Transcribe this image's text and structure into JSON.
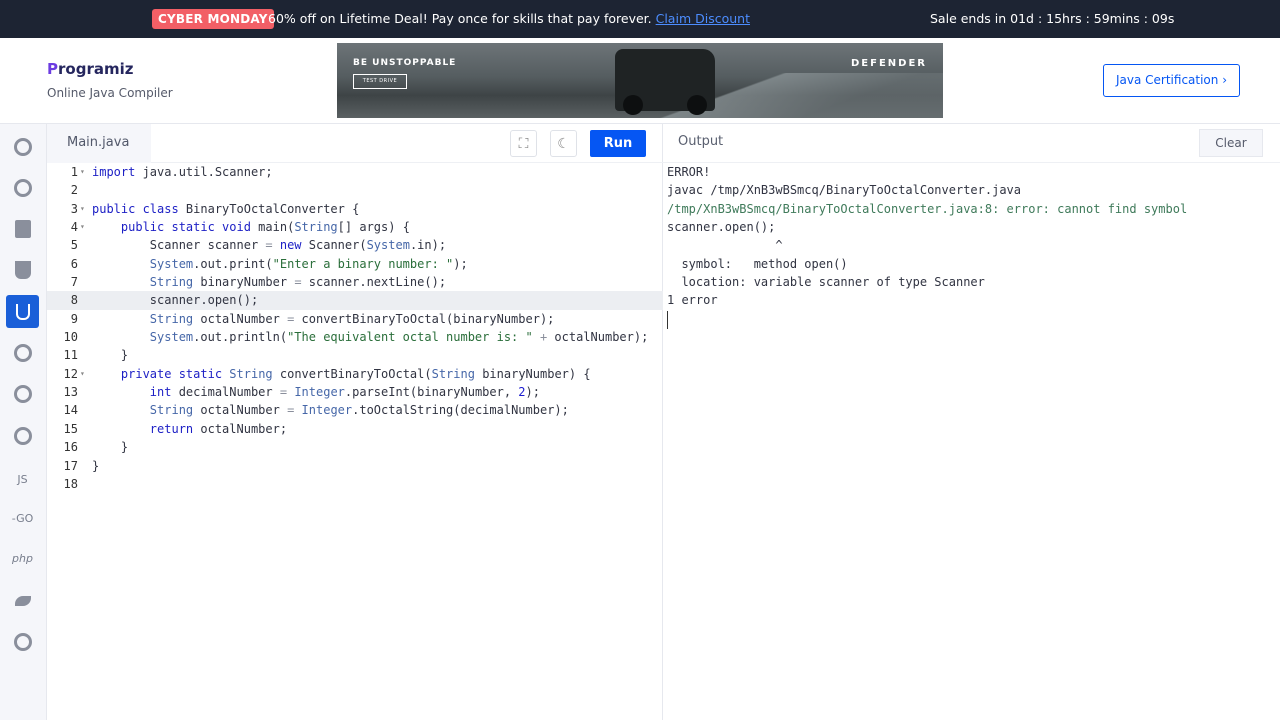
{
  "promo": {
    "badge": "CYBER MONDAY",
    "message": "60% off on Lifetime Deal! Pay once for skills that pay forever.",
    "link": "Claim Discount",
    "timer": "Sale ends in 01d : 15hrs : 59mins : 09s"
  },
  "header": {
    "logo": "rogramiz",
    "logo_p": "P",
    "subtitle": "Online Java Compiler",
    "ad_tagline": "BE UNSTOPPABLE",
    "ad_button": "TEST DRIVE",
    "ad_brand": "DEFENDER",
    "cert_button": "Java Certification ›"
  },
  "sidebar": {
    "items": [
      {
        "name": "python"
      },
      {
        "name": "r"
      },
      {
        "name": "sql"
      },
      {
        "name": "html"
      },
      {
        "name": "java",
        "active": true
      },
      {
        "name": "c"
      },
      {
        "name": "cpp"
      },
      {
        "name": "csharp"
      },
      {
        "name": "js",
        "label": "JS"
      },
      {
        "name": "go",
        "label": "-GO"
      },
      {
        "name": "php",
        "label": "php"
      },
      {
        "name": "swift"
      },
      {
        "name": "rust"
      }
    ]
  },
  "editor": {
    "file_tab": "Main.java",
    "run_label": "Run",
    "lines": [
      "import java.util.Scanner;",
      "",
      "public class BinaryToOctalConverter {",
      "    public static void main(String[] args) {",
      "        Scanner scanner = new Scanner(System.in);",
      "        System.out.print(\"Enter a binary number: \");",
      "        String binaryNumber = scanner.nextLine();",
      "        scanner.open();",
      "        String octalNumber = convertBinaryToOctal(binaryNumber);",
      "        System.out.println(\"The equivalent octal number is: \" + octalNumber);",
      "    }",
      "    private static String convertBinaryToOctal(String binaryNumber) {",
      "        int decimalNumber = Integer.parseInt(binaryNumber, 2);",
      "        String octalNumber = Integer.toOctalString(decimalNumber);",
      "        return octalNumber;",
      "    }",
      "}",
      ""
    ],
    "line_numbers": [
      "1",
      "2",
      "3",
      "4",
      "5",
      "6",
      "7",
      "8",
      "9",
      "10",
      "11",
      "12",
      "13",
      "14",
      "15",
      "16",
      "17",
      "18"
    ]
  },
  "output": {
    "title": "Output",
    "clear_label": "Clear",
    "lines": [
      "ERROR!",
      "javac /tmp/XnB3wBSmcq/BinaryToOctalConverter.java",
      "/tmp/XnB3wBSmcq/BinaryToOctalConverter.java:8: error: cannot find symbol",
      "scanner.open();",
      "               ^",
      "  symbol:   method open()",
      "  location: variable scanner of type Scanner",
      "1 error"
    ]
  }
}
